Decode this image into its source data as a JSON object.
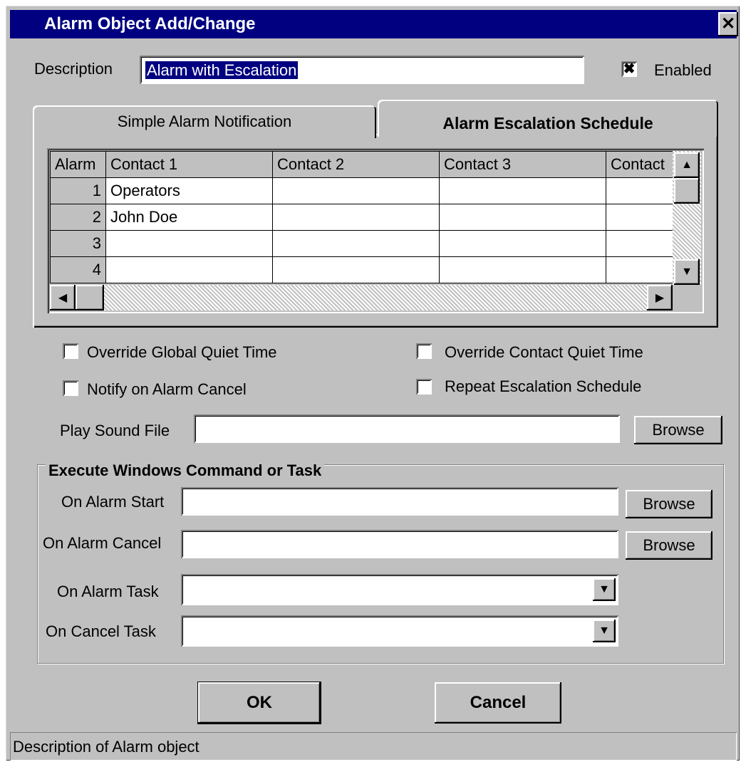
{
  "window": {
    "title": "Alarm Object Add/Change",
    "close_glyph": "✕"
  },
  "description": {
    "label": "Description",
    "value": "Alarm with Escalation"
  },
  "enabled": {
    "label": "Enabled",
    "checked": true,
    "mark": "✖"
  },
  "tabs": [
    {
      "label": "Simple Alarm Notification",
      "active": false
    },
    {
      "label": "Alarm Escalation Schedule",
      "active": true
    }
  ],
  "grid": {
    "columns": [
      "Alarm",
      "Contact 1",
      "Contact 2",
      "Contact 3",
      "Contact"
    ],
    "rows": [
      {
        "num": "1",
        "c1": "Operators",
        "c2": "",
        "c3": "",
        "c4": ""
      },
      {
        "num": "2",
        "c1": "John Doe",
        "c2": "",
        "c3": "",
        "c4": ""
      },
      {
        "num": "3",
        "c1": "",
        "c2": "",
        "c3": "",
        "c4": ""
      },
      {
        "num": "4",
        "c1": "",
        "c2": "",
        "c3": "",
        "c4": ""
      }
    ]
  },
  "options": {
    "override_global_quiet": "Override Global Quiet Time",
    "notify_on_cancel": "Notify on Alarm Cancel",
    "override_contact_quiet": "Override Contact Quiet Time",
    "repeat_escalation": "Repeat Escalation Schedule"
  },
  "sound": {
    "label": "Play Sound File",
    "value": "",
    "browse": "Browse"
  },
  "exec_group": {
    "title": "Execute Windows Command or Task",
    "on_alarm_start": "On Alarm Start",
    "on_alarm_cancel": "On Alarm Cancel",
    "on_alarm_task": "On Alarm Task",
    "on_cancel_task": "On Cancel Task",
    "browse": "Browse"
  },
  "buttons": {
    "ok": "OK",
    "cancel": "Cancel"
  },
  "status": "Description of Alarm object",
  "icons": {
    "up": "▲",
    "down": "▼",
    "left": "◀",
    "right": "▶"
  },
  "colors": {
    "title_bar": "#000080",
    "face": "#c0c0c0"
  }
}
